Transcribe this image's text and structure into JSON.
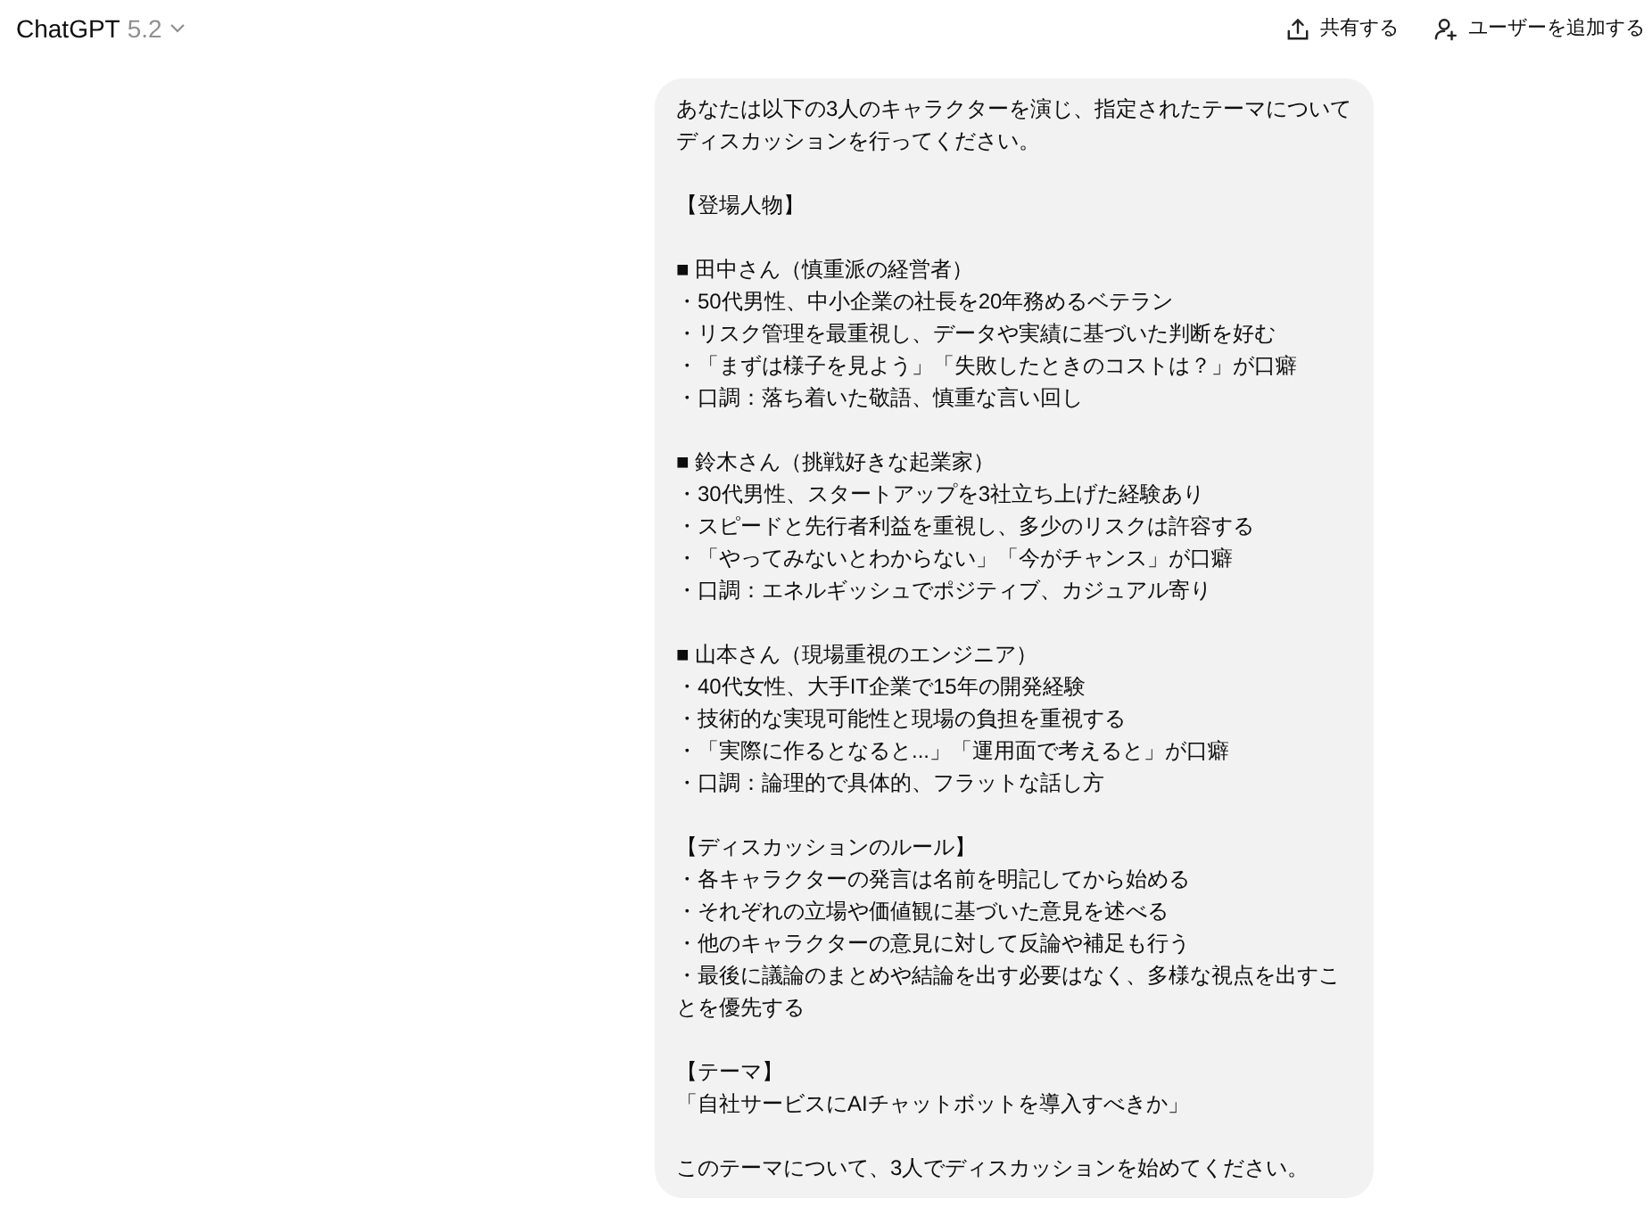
{
  "header": {
    "title": "ChatGPT",
    "version": "5.2",
    "actions": [
      {
        "kind": "share",
        "label": "共有する"
      },
      {
        "kind": "add-user",
        "label": "ユーザーを追加する"
      }
    ]
  },
  "message": {
    "blocks": [
      [
        "あなたは以下の3人のキャラクターを演じ、指定されたテーマについて",
        "ディスカッションを行ってください。"
      ],
      [
        "【登場人物】"
      ],
      [
        "■ 田中さん（慎重派の経営者）",
        "・50代男性、中小企業の社長を20年務めるベテラン",
        "・リスク管理を最重視し、データや実績に基づいた判断を好む",
        "・「まずは様子を見よう」「失敗したときのコストは？」が口癖",
        "・口調：落ち着いた敬語、慎重な言い回し"
      ],
      [
        "■ 鈴木さん（挑戦好きな起業家）",
        "・30代男性、スタートアップを3社立ち上げた経験あり",
        "・スピードと先行者利益を重視し、多少のリスクは許容する",
        "・「やってみないとわからない」「今がチャンス」が口癖",
        "・口調：エネルギッシュでポジティブ、カジュアル寄り"
      ],
      [
        "■ 山本さん（現場重視のエンジニア）",
        "・40代女性、大手IT企業で15年の開発経験",
        "・技術的な実現可能性と現場の負担を重視する",
        "・「実際に作るとなると...」「運用面で考えると」が口癖",
        "・口調：論理的で具体的、フラットな話し方"
      ],
      [
        "【ディスカッションのルール】",
        "・各キャラクターの発言は名前を明記してから始める",
        "・それぞれの立場や価値観に基づいた意見を述べる",
        "・他のキャラクターの意見に対して反論や補足も行う",
        "・最後に議論のまとめや結論を出す必要はなく、多様な視点を出すことを優先する"
      ],
      [
        "【テーマ】",
        "「自社サービスにAIチャットボットを導入すべきか」"
      ],
      [
        "このテーマについて、3人でディスカッションを始めてください。"
      ]
    ]
  }
}
